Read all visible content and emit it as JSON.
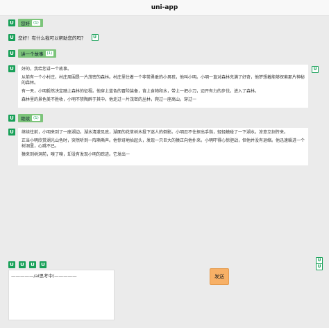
{
  "header": {
    "title": "uni-app"
  },
  "icon_letter": "U",
  "messages": {
    "m1_user": {
      "text": "您好",
      "badge": "(1)"
    },
    "m2_ai": {
      "text": "您好！有什么我可以帮助您的吗？"
    },
    "m3_user": {
      "text": "讲一个故事",
      "badge": "(1)"
    },
    "m4_ai": {
      "paragraphs": [
        "好的，我给您讲一个故事。",
        "从前有一个小村庄，村庄周围是一片茂密的森林。村庄里住着一个非常勇敢的小男孩，他叫小明。小明一直对森林充满了好奇，他梦想着能够探索那片神秘的森林。",
        "有一天，小明毅然决定踏上森林的征程。他穿上蓝色的冒险装备，背上食物和水，带上一把小刀，迈开有力的步伐，进入了森林。",
        "森林里的景色美不胜收，小明不禁陶醉于其中。他走过一片茂密的丛林，爬过一座高山，穿过一"
      ]
    },
    "m5_user": {
      "text": "继续",
      "badge": "(1)"
    },
    "m6_ai": {
      "paragraphs": [
        "继续往前，小明来到了一座湖边。湖水清澈见底，湖面的花草树木投下迷人的倒影。小明忍不住探出手指，轻轻触碰了一下湖水，凉意立刻传来。",
        "正当小明欣赏湖光山色时，突然听到一阵嘶嘶声。他惊讶地抬起头，发现一只巨大的猿正向他扑来。小明吓得心惊胆战，但他并没有退缩。他迅速躲进一个树洞里，心跳不已。",
        "猿来到树洞前，嗅了嗅，却没有发现小明的踪迹。它发出一"
      ]
    }
  },
  "input": {
    "text": "—————/ai思考中/—————"
  },
  "send_button": {
    "label": "发送"
  }
}
